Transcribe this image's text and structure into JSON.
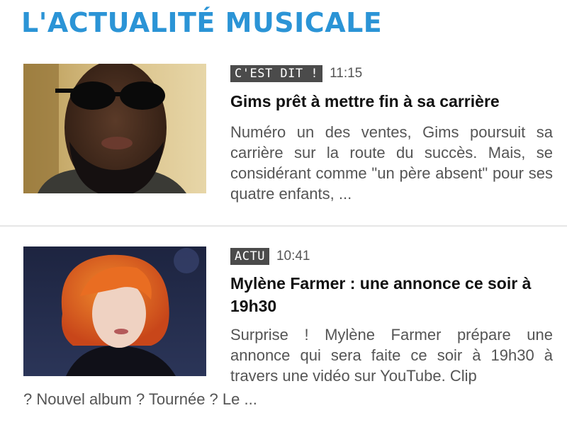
{
  "section": {
    "title": "L'ACTUALITÉ MUSICALE",
    "color": "#2b94d6"
  },
  "articles": [
    {
      "tag": "C'EST DIT !",
      "time": "11:15",
      "headline": "Gims prêt à mettre fin à sa carrière",
      "excerpt": "Numéro un des ventes, Gims poursuit sa carrière sur la route du succès. Mais, se considérant comme \"un père absent\" pour ses quatre enfants, ..."
    },
    {
      "tag": "ACTU",
      "time": "10:41",
      "headline": "Mylène Farmer : une annonce ce soir à 19h30",
      "excerpt_side": "Surprise ! Mylène Farmer prépare une annonce qui sera faite ce soir à 19h30 à travers une vidéo sur YouTube. Clip",
      "excerpt_wrap": "? Nouvel album ? Tournée ? Le ..."
    }
  ]
}
